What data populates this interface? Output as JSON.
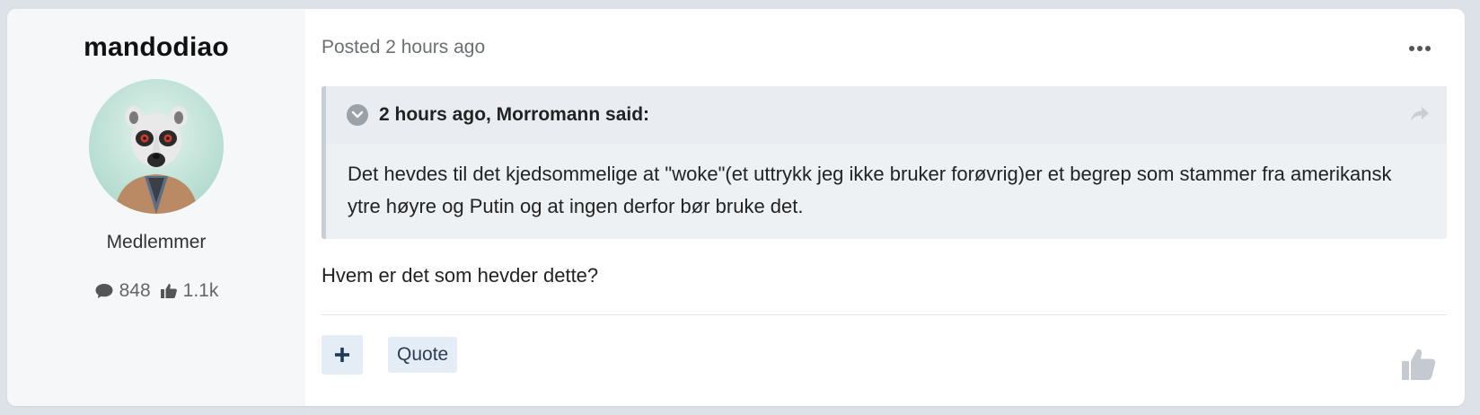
{
  "author": {
    "name": "mandodiao",
    "group": "Medlemmer",
    "posts_count": "848",
    "reputation": "1.1k"
  },
  "post": {
    "posted": "Posted 2 hours ago",
    "quote": {
      "cite": "2 hours ago, Morromann said:",
      "text": "Det hevdes til det kjedsommelige at \"woke\"(et uttrykk jeg ikke bruker forøvrig)er et begrep som stammer fra amerikansk ytre høyre og Putin og at ingen derfor bør bruke det."
    },
    "body": "Hvem er det som hevder dette?"
  },
  "actions": {
    "quote_label": "Quote"
  },
  "colors": {
    "page_bg": "#dde2e8",
    "author_panel_bg": "#f6f7f9",
    "quote_bg": "#eef1f4",
    "button_bg": "#e4edf6",
    "accent_dark": "#1f3a5a"
  },
  "icons": {
    "more": "more-horizontal-icon",
    "quote_toggle": "chevron-down-icon",
    "share": "share-arrow-icon",
    "comment": "comment-icon",
    "thumbs_up": "thumbs-up-icon",
    "plus": "plus-icon",
    "like": "like-icon"
  }
}
